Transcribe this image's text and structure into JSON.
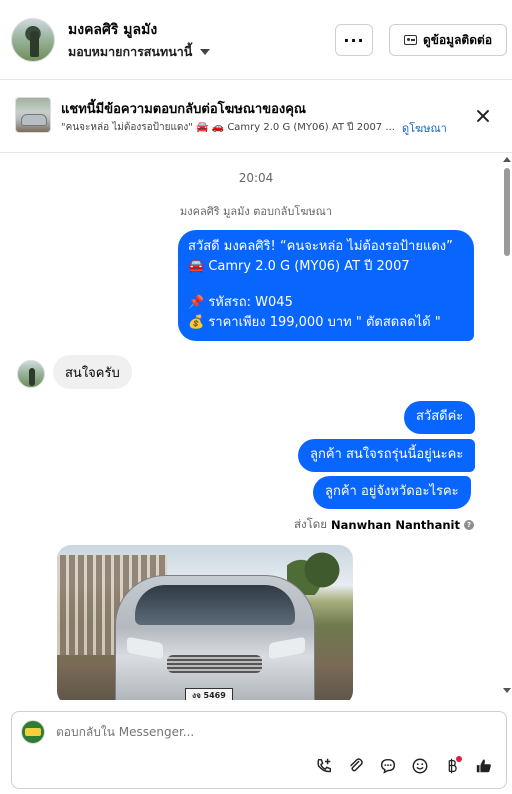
{
  "header": {
    "contact_name": "มงคลศิริ มูลมัง",
    "assign_label": "มอบหมายการสนทนานี้",
    "more_label": "···",
    "view_contact_label": "ดูข้อมูลติดต่อ"
  },
  "ad_banner": {
    "title": "แชทนี้มีข้อความตอบกลับต่อโฆษณาของคุณ",
    "description": "\"คนจะหล่อ ไม่ต้องรอป้ายแดง\" 🚘 🚗 Camry 2.0 G (MY06) AT ปี 2007 ...",
    "view_ad_label": "ดูโฆษณา"
  },
  "conversation": {
    "timestamp": "20:04",
    "ad_reply_notice": "มงคลศิริ มูลมัง ตอบกลับโฆษณา",
    "outgoing_ad_message": {
      "line1": "สวัสดี มงคลศิริ! “คนจะหล่อ ไม่ต้องรอป้ายแดง”",
      "line2": "🚘 Camry 2.0 G (MY06) AT ปี 2007",
      "line3": "📌 รหัสรถ: W045",
      "line4": "💰 ราคาเพียง 199,000 บาท \" ตัดสดลดได้ \""
    },
    "incoming_message": "สนใจครับ",
    "outgoing_messages": [
      "สวัสดีค่ะ",
      "ลูกค้า สนใจรถรุ่นนี้อยู่นะคะ",
      "ลูกค้า อยู่จังหวัดอะไรคะ"
    ],
    "sent_by_prefix": "ส่งโดย",
    "sent_by_name": "Nanwhan Nanthanit",
    "photo_plate_text": "งจ 5469"
  },
  "composer": {
    "placeholder": "ตอบกลับใน Messenger..."
  },
  "colors": {
    "outgoing_bubble": "#0866ff",
    "incoming_bubble": "#f0f0f0",
    "link": "#1565c0"
  }
}
